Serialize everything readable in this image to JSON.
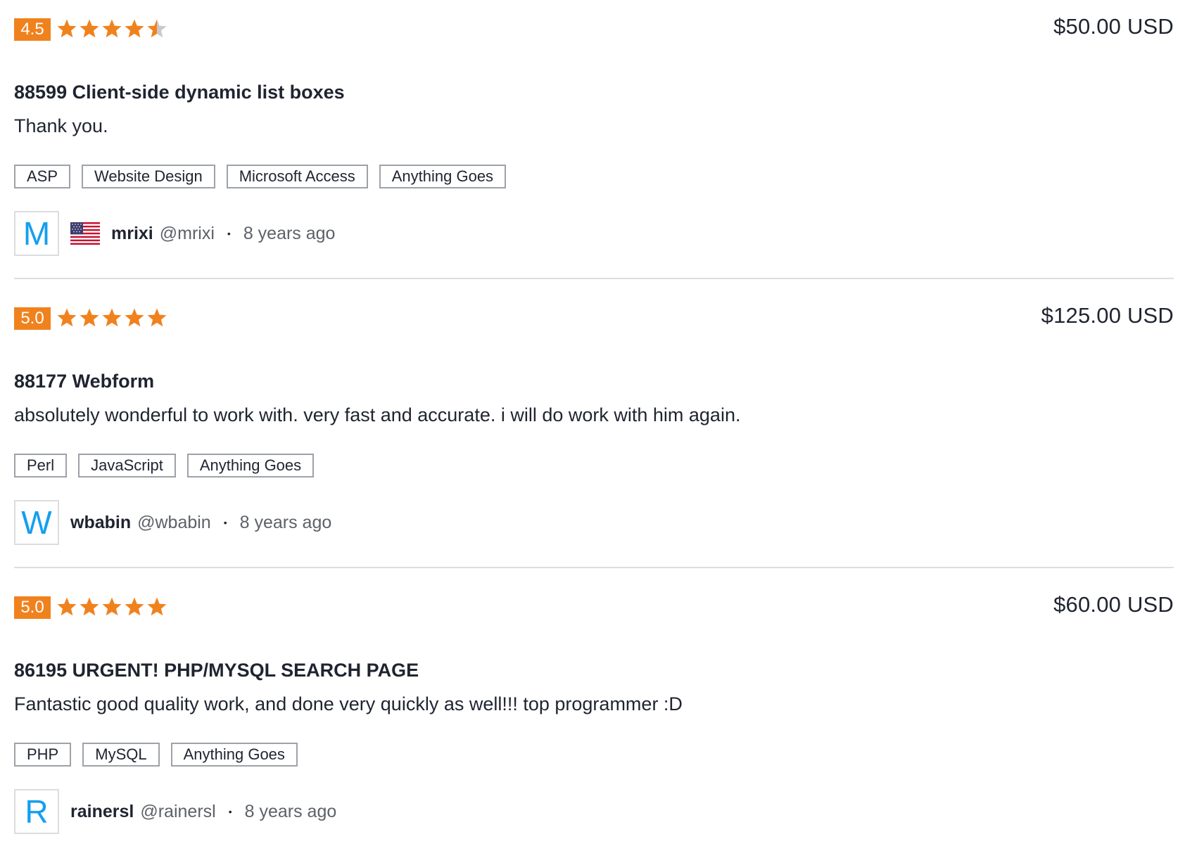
{
  "reviews": [
    {
      "rating": "4.5",
      "rating_value": 4.5,
      "price": "$50.00 USD",
      "title": "88599 Client-side dynamic list boxes",
      "comment": "Thank you.",
      "tags": [
        "ASP",
        "Website Design",
        "Microsoft Access",
        "Anything Goes"
      ],
      "avatar_letter": "M",
      "flag": "us-flag-icon",
      "username": "mrixi",
      "handle": "@mrixi",
      "separator": "•",
      "time_ago": "8 years ago"
    },
    {
      "rating": "5.0",
      "rating_value": 5.0,
      "price": "$125.00 USD",
      "title": "88177 Webform",
      "comment": "absolutely wonderful to work with. very fast and accurate. i will do work with him again.",
      "tags": [
        "Perl",
        "JavaScript",
        "Anything Goes"
      ],
      "avatar_letter": "W",
      "flag": null,
      "username": "wbabin",
      "handle": "@wbabin",
      "separator": "•",
      "time_ago": "8 years ago"
    },
    {
      "rating": "5.0",
      "rating_value": 5.0,
      "price": "$60.00 USD",
      "title": "86195 URGENT! PHP/MYSQL SEARCH PAGE",
      "comment": "Fantastic good quality work, and done very quickly as well!!! top programmer :D",
      "tags": [
        "PHP",
        "MySQL",
        "Anything Goes"
      ],
      "avatar_letter": "R",
      "flag": null,
      "username": "rainersl",
      "handle": "@rainersl",
      "separator": "•",
      "time_ago": "8 years ago"
    }
  ],
  "colors": {
    "rating_badge": "#f0821e",
    "star_filled": "#f0821e",
    "star_empty": "#c7c9cc",
    "avatar_letter": "#139ff0",
    "divider": "#dcdde0"
  }
}
